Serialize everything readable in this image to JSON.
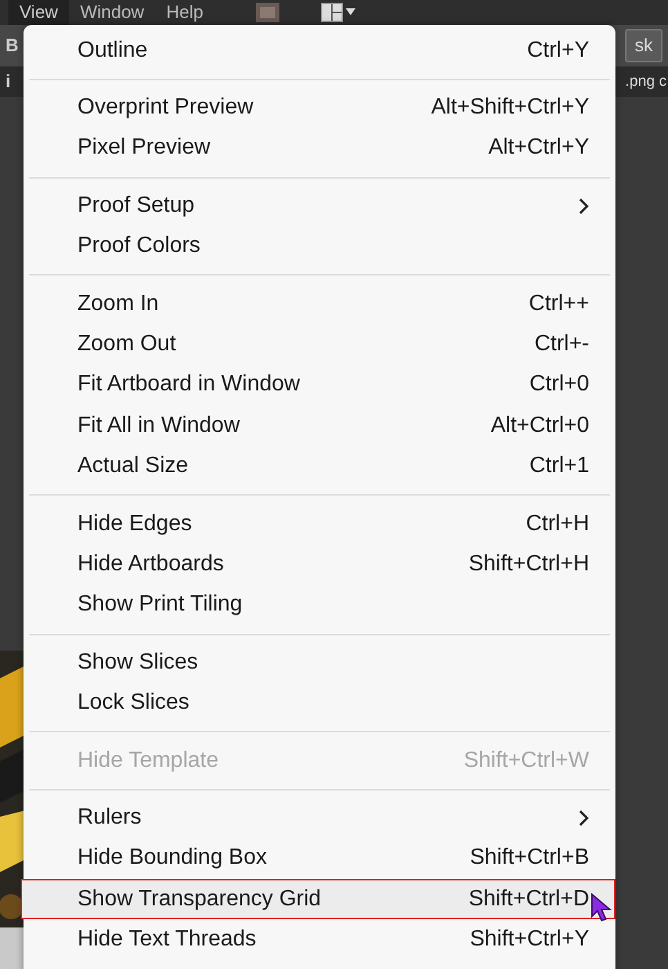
{
  "menubar": [
    {
      "label": "View",
      "selected": true
    },
    {
      "label": "Window",
      "selected": false
    },
    {
      "label": "Help",
      "selected": false
    }
  ],
  "background": {
    "left_fragments": [
      "B",
      "i"
    ],
    "right_button": "sk",
    "right_tab": ".png c"
  },
  "menu": {
    "groups": [
      {
        "items": [
          {
            "label": "Outline",
            "shortcut": "Ctrl+Y",
            "submenu": false,
            "disabled": false,
            "selected": false
          }
        ]
      },
      {
        "items": [
          {
            "label": "Overprint Preview",
            "shortcut": "Alt+Shift+Ctrl+Y",
            "submenu": false,
            "disabled": false,
            "selected": false
          },
          {
            "label": "Pixel Preview",
            "shortcut": "Alt+Ctrl+Y",
            "submenu": false,
            "disabled": false,
            "selected": false
          }
        ]
      },
      {
        "items": [
          {
            "label": "Proof Setup",
            "submenu": true,
            "disabled": false,
            "selected": false
          },
          {
            "label": "Proof Colors",
            "submenu": false,
            "disabled": false,
            "selected": false
          }
        ]
      },
      {
        "items": [
          {
            "label": "Zoom In",
            "shortcut": "Ctrl++",
            "submenu": false,
            "disabled": false,
            "selected": false
          },
          {
            "label": "Zoom Out",
            "shortcut": "Ctrl+-",
            "submenu": false,
            "disabled": false,
            "selected": false
          },
          {
            "label": "Fit Artboard in Window",
            "shortcut": "Ctrl+0",
            "submenu": false,
            "disabled": false,
            "selected": false
          },
          {
            "label": "Fit All in Window",
            "shortcut": "Alt+Ctrl+0",
            "submenu": false,
            "disabled": false,
            "selected": false
          },
          {
            "label": "Actual Size",
            "shortcut": "Ctrl+1",
            "submenu": false,
            "disabled": false,
            "selected": false
          }
        ]
      },
      {
        "items": [
          {
            "label": "Hide Edges",
            "shortcut": "Ctrl+H",
            "submenu": false,
            "disabled": false,
            "selected": false
          },
          {
            "label": "Hide Artboards",
            "shortcut": "Shift+Ctrl+H",
            "submenu": false,
            "disabled": false,
            "selected": false
          },
          {
            "label": "Show Print Tiling",
            "submenu": false,
            "disabled": false,
            "selected": false
          }
        ]
      },
      {
        "items": [
          {
            "label": "Show Slices",
            "submenu": false,
            "disabled": false,
            "selected": false
          },
          {
            "label": "Lock Slices",
            "submenu": false,
            "disabled": false,
            "selected": false
          }
        ]
      },
      {
        "items": [
          {
            "label": "Hide Template",
            "shortcut": "Shift+Ctrl+W",
            "submenu": false,
            "disabled": true,
            "selected": false
          }
        ]
      },
      {
        "items": [
          {
            "label": "Rulers",
            "submenu": true,
            "disabled": false,
            "selected": false
          },
          {
            "label": "Hide Bounding Box",
            "shortcut": "Shift+Ctrl+B",
            "submenu": false,
            "disabled": false,
            "selected": false
          },
          {
            "label": "Show Transparency Grid",
            "shortcut": "Shift+Ctrl+D",
            "submenu": false,
            "disabled": false,
            "selected": true
          },
          {
            "label": "Hide Text Threads",
            "shortcut": "Shift+Ctrl+Y",
            "submenu": false,
            "disabled": false,
            "selected": false
          }
        ]
      }
    ]
  }
}
